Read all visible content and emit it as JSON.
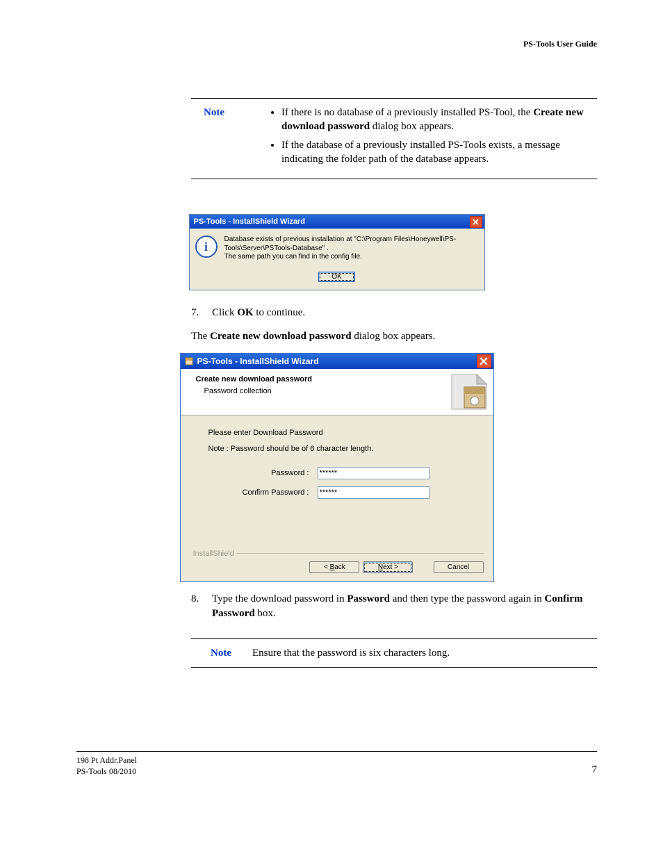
{
  "header": {
    "doc_title": "PS-Tools User Guide"
  },
  "note1": {
    "label": "Note",
    "bullets": [
      {
        "pre": "If there is no database of a previously installed PS-Tool, the ",
        "bold": "Create new download password",
        "post": " dialog box appears."
      },
      {
        "pre": "If the database of a previously installed PS-Tools exists, a message indicating the folder path of the database appears.",
        "bold": "",
        "post": ""
      }
    ]
  },
  "msgbox": {
    "title": "PS-Tools - InstallShield Wizard",
    "text_line1": "Database exists of previous installation at \"C:\\Program Files\\Honeywell\\PS-Tools\\Server\\PSTools-Database\" .",
    "text_line2": "The same path you can find in the config file.",
    "ok": "OK"
  },
  "step7": {
    "num": "7.",
    "pre": "Click ",
    "bold": "OK",
    "post": " to continue."
  },
  "para_after7": {
    "pre": "The ",
    "bold": "Create new download password",
    "post": " dialog box appears."
  },
  "wizard": {
    "title": "PS-Tools - InstallShield Wizard",
    "header_title": "Create new download password",
    "header_sub": "Password collection",
    "line1": "Please enter Download Password",
    "line2": "Note : Password should be of 6 character length.",
    "pwd_label": "Password :",
    "cpwd_label": "Confirm Password :",
    "pwd_value": "******",
    "cpwd_value": "******",
    "brand": "InstallShield",
    "back": "< Back",
    "next": "Next >",
    "cancel": "Cancel"
  },
  "step8": {
    "num": "8.",
    "t1": "Type the download password in ",
    "b1": "Password",
    "t2": " and then type the password again in ",
    "b2": "Confirm Password",
    "t3": " box."
  },
  "note2": {
    "label": "Note",
    "text": "Ensure that the password is six characters long."
  },
  "footer": {
    "l1": "198 Pt Addr.Panel",
    "l2": "PS-Tools  08/2010",
    "page": "7"
  }
}
